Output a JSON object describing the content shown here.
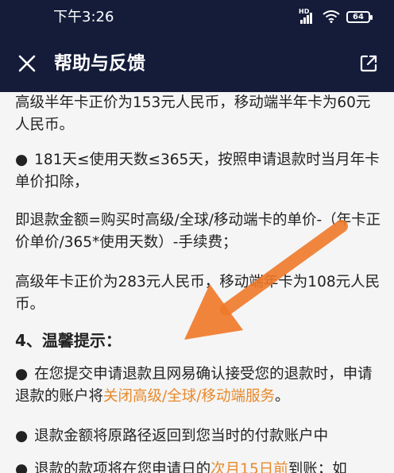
{
  "status_bar": {
    "time": "下午3:26",
    "network_label": "HD",
    "battery": "64",
    "icons": [
      "hd-signal-icon",
      "wifi-icon",
      "battery-icon"
    ]
  },
  "app_bar": {
    "title": "帮助与反馈",
    "close_icon": "close-icon",
    "share_icon": "open-external-icon"
  },
  "content": {
    "p1": "高级半年卡正价为153元人民币，移动端半年卡为60元人民币。",
    "p2_bullet": "●",
    "p2": "181天≤使用天数≤365天，按照申请退款时当月年卡单价扣除，",
    "p3": "即退款金额=购买时高级/全球/移动端卡的单价-（年卡正价单价/365*使用天数）-手续费；",
    "p4": "高级年卡正价为283元人民币，移动端年卡为108元人民币。",
    "section_heading": "4、温馨提示：",
    "p5_bullet": "●",
    "p5_a": "在您提交申请退款且网易确认接受您的退款时，申请退款的账户将",
    "p5_link": "关闭高级/全球/移动端服务",
    "p5_b": "。",
    "p6_bullet": "●",
    "p6": "退款金额将原路径返回到您当时的付款账户中",
    "p7_bullet": "●",
    "p7_a": "退款的款项将在您申请日的",
    "p7_link": "次月15日前",
    "p7_b": "到账；如"
  },
  "colors": {
    "header_bg": "#141c3a",
    "link": "#e8892a",
    "arrow": "#f07a2a"
  }
}
